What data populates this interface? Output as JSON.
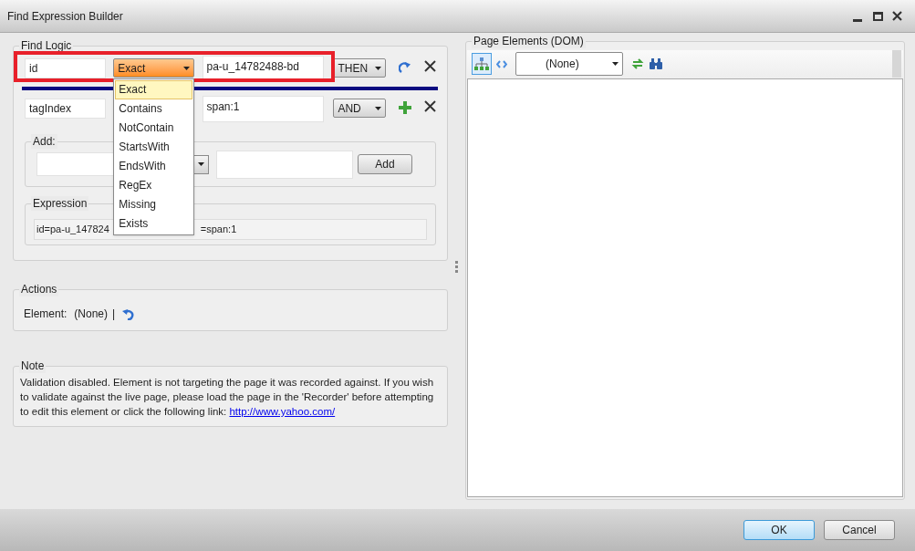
{
  "window": {
    "title": "Find Expression Builder"
  },
  "find_logic": {
    "title": "Find Logic",
    "rules": [
      {
        "attribute": "id",
        "comparison": "Exact",
        "comparison_open": true,
        "value": "pa-u_14782488-bd",
        "operator": "THEN",
        "kind": "redo",
        "highlighted": true
      },
      {
        "attribute": "tagIndex",
        "value": "span:1",
        "operator": "AND",
        "kind": "add",
        "highlighted": false
      }
    ],
    "comparison_options": [
      {
        "label": "Exact",
        "selected": true
      },
      {
        "label": "Contains",
        "selected": false
      },
      {
        "label": "NotContain",
        "selected": false
      },
      {
        "label": "StartsWith",
        "selected": false
      },
      {
        "label": "EndsWith",
        "selected": false
      },
      {
        "label": "RegEx",
        "selected": false
      },
      {
        "label": "Missing",
        "selected": false
      },
      {
        "label": "Exists",
        "selected": false
      }
    ],
    "add": {
      "title": "Add:",
      "button": "Add"
    },
    "expression": {
      "title": "Expression",
      "visible_start": "id=pa-u_147824",
      "visible_end": "=span:1"
    }
  },
  "actions": {
    "title": "Actions",
    "label": "Element:",
    "value": "(None)",
    "separator": "|"
  },
  "note": {
    "title": "Note",
    "text": "Validation disabled. Element is not targeting the page it was recorded against. If you wish to validate against the live page, please load the page in the 'Recorder' before attempting to edit this element or click the following link:",
    "link": "http://www.yahoo.com/"
  },
  "dom": {
    "title": "Page Elements (DOM)",
    "tree_view_selected": true,
    "selector": "(None)"
  },
  "buttons": [
    {
      "label": "OK",
      "default": true
    },
    {
      "label": "Cancel",
      "default": false
    }
  ]
}
